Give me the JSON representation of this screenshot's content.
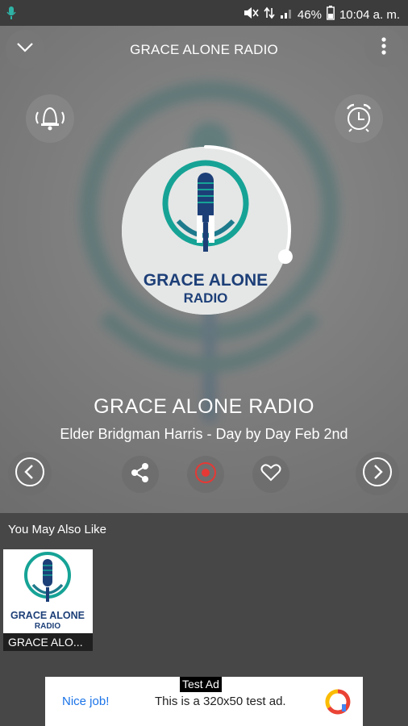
{
  "status": {
    "battery": "46%",
    "time": "10:04 a. m."
  },
  "header": {
    "title": "GRACE ALONE RADIO"
  },
  "player": {
    "station": "GRACE ALONE RADIO",
    "track": "Elder Bridgman Harris - Day by Day Feb 2nd",
    "logo_line1": "GRACE ALONE",
    "logo_line2": "RADIO",
    "progress_fraction": 0.3,
    "icons": {
      "collapse": "chevron-down-icon",
      "menu": "more-vertical-icon",
      "notify": "bell-icon",
      "alarm": "alarm-clock-icon",
      "play_state": "pause-icon",
      "prev": "chevron-left-icon",
      "share": "share-icon",
      "record": "record-icon",
      "favorite": "heart-icon",
      "next": "chevron-right-icon"
    }
  },
  "similar": {
    "title": "You May Also Like",
    "items": [
      {
        "label": "GRACE ALO...",
        "logo_line1": "GRACE ALONE",
        "logo_line2": "RADIO"
      }
    ]
  },
  "ad": {
    "tag": "Test Ad",
    "cta": "Nice job!",
    "text": "This is a 320x50 test ad."
  },
  "colors": {
    "accent_record": "#e53935",
    "brand_teal": "#16a396",
    "brand_navy": "#1d3f78",
    "ad_link": "#1a73e8"
  }
}
